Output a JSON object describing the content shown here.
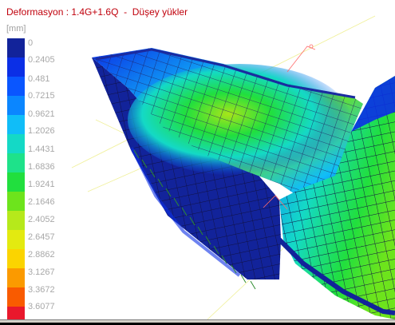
{
  "viewport": {
    "title": "Deformasyon : 1.4G+1.6Q  -  Düşey yükler",
    "unit": "[mm]"
  },
  "legend": {
    "labels": [
      "0",
      "0.2405",
      "0.481",
      "0.7215",
      "0.9621",
      "1.2026",
      "1.4431",
      "1.6836",
      "1.9241",
      "2.1646",
      "2.4052",
      "2.6457",
      "2.8862",
      "3.1267",
      "3.3672",
      "3.6077"
    ],
    "colors": [
      "#12239a",
      "#0b2fe6",
      "#0a56ff",
      "#0b86ff",
      "#10bdf8",
      "#14d9c6",
      "#1ee28a",
      "#21df3e",
      "#6de41c",
      "#b6e91b",
      "#e3ea10",
      "#fbd400",
      "#fb9a00",
      "#f95b00",
      "#e9182c",
      "#cc0a55"
    ]
  },
  "colors": {
    "title": "#c0000c",
    "mesh_dark": "#1a2ba0",
    "grid_lines": "#202060",
    "support_springs": "#2e8b2e",
    "axis_lines": "#f0f09a",
    "highlight": "#ff6a6a"
  }
}
